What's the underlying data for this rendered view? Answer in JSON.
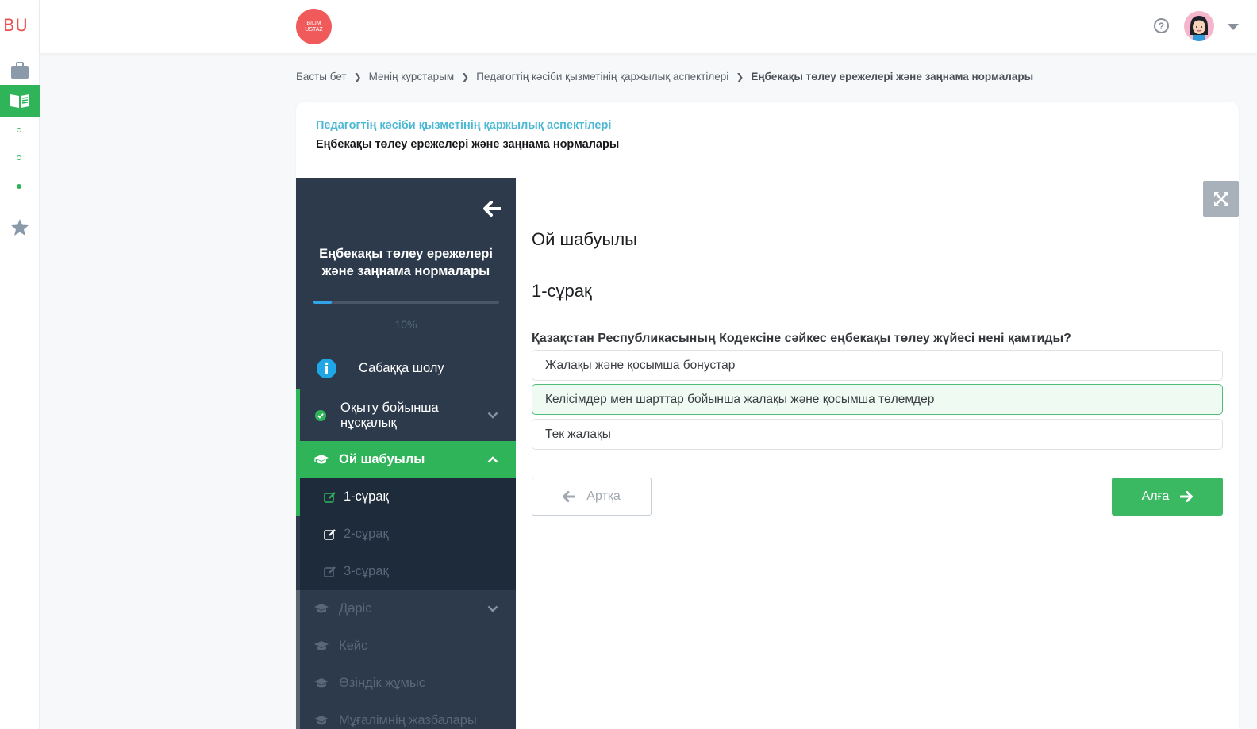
{
  "rail": {
    "logo_text": "BU",
    "items": [
      "briefcase-icon",
      "open-book-icon",
      "star-icon"
    ],
    "accent": "#2fb45a"
  },
  "topbar": {
    "brand_line1": "BILIM",
    "brand_line2": "USTAZ",
    "help_symbol": "?"
  },
  "breadcrumb": {
    "items": [
      "Басты бет",
      "Менің курстарым",
      "Педагогтің кәсіби қызметінің қаржылық аспектілері",
      "Еңбекақы төлеу ережелері және заңнама нормалары"
    ]
  },
  "card": {
    "course_title": "Педагогтің кәсіби қызметінің қаржылық аспектілері",
    "lesson_title": "Еңбекақы төлеу ережелері және заңнама нормалары"
  },
  "sidebar": {
    "title": "Еңбекақы төлеу ережелері және заңнама нормалары",
    "progress_percent": 10,
    "progress_label": "10%",
    "overview_label": "Сабаққа шолу",
    "guide_label": "Оқыту бойынша нұсқалық",
    "brainstorm_label": "Ой шабуылы",
    "questions": [
      "1-сұрақ",
      "2-сұрақ",
      "3-сұрақ"
    ],
    "lecture_label": "Дәріс",
    "case_label": "Кейс",
    "self_work_label": "Өзіндік жұмыс",
    "teacher_notes_label": "Мұғалімнің жазбалары"
  },
  "main": {
    "section_heading": "Ой шабуылы",
    "question_number": "1-сұрақ",
    "question_text": "Қазақстан Республикасының Кодексіне сәйкес еңбекақы төлеу жүйесі нені қамтиды?",
    "options": [
      "Жалақы және қосымша бонустар",
      "Келісімдер мен шарттар бойынша жалақы және қосымша төлемдер",
      "Тек жалақы"
    ],
    "selected_option": 1,
    "back_label": "Артқа",
    "next_label": "Алға"
  }
}
